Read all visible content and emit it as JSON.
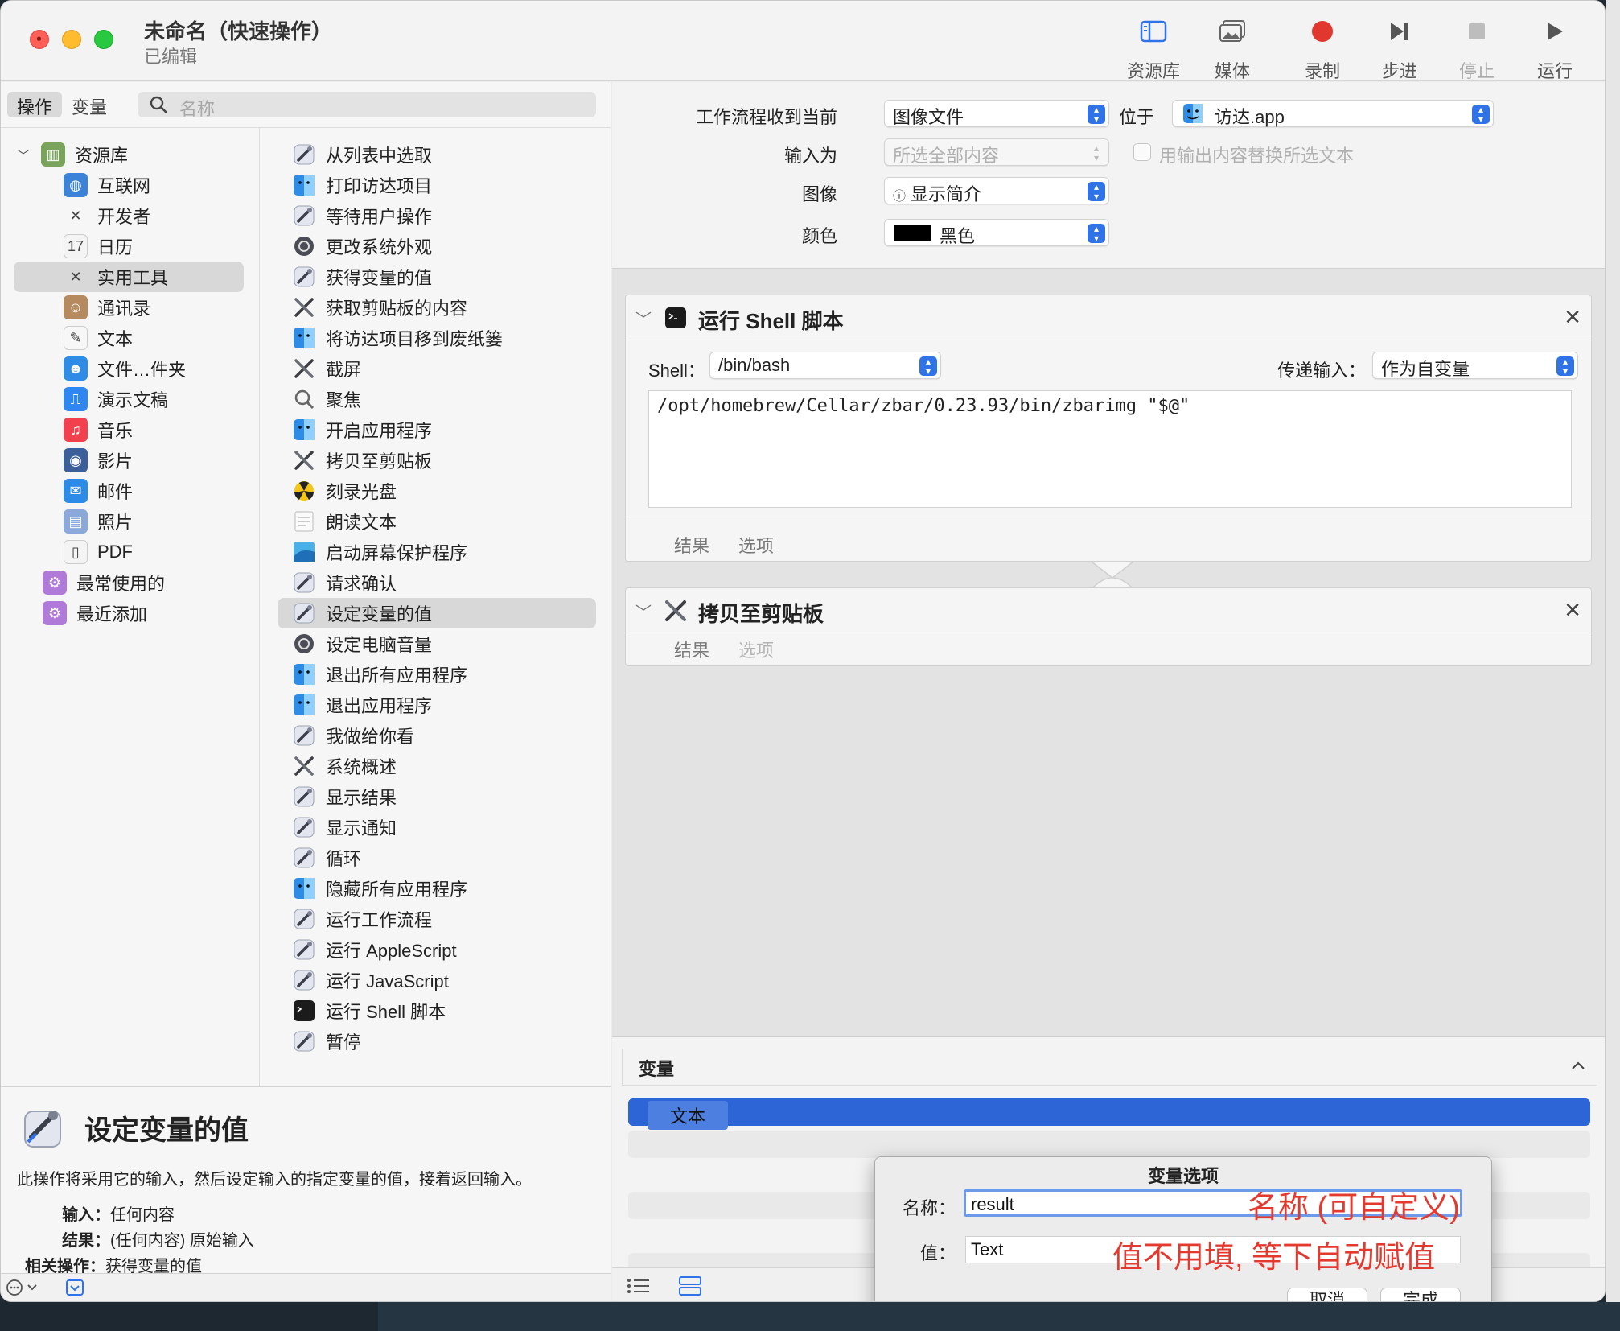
{
  "window": {
    "title": "未命名（快速操作）",
    "subtitle": "已编辑"
  },
  "toolbar": {
    "library": "资源库",
    "media": "媒体",
    "record": "录制",
    "step": "步进",
    "stop": "停止",
    "run": "运行"
  },
  "left": {
    "seg_actions": "操作",
    "seg_variables": "变量",
    "search_placeholder": "名称",
    "library_items": [
      {
        "label": "资源库",
        "icon": "library-icon"
      },
      {
        "label": "互联网",
        "icon": "globe-icon"
      },
      {
        "label": "开发者",
        "icon": "tools-icon"
      },
      {
        "label": "日历",
        "icon": "calendar-icon"
      },
      {
        "label": "实用工具",
        "icon": "tools-icon"
      },
      {
        "label": "通讯录",
        "icon": "contacts-icon"
      },
      {
        "label": "文本",
        "icon": "text-icon"
      },
      {
        "label": "文件…件夹",
        "icon": "finder-icon"
      },
      {
        "label": "演示文稿",
        "icon": "keynote-icon"
      },
      {
        "label": "音乐",
        "icon": "music-icon"
      },
      {
        "label": "影片",
        "icon": "movie-icon"
      },
      {
        "label": "邮件",
        "icon": "mail-icon"
      },
      {
        "label": "照片",
        "icon": "photos-icon"
      },
      {
        "label": "PDF",
        "icon": "pdf-icon"
      },
      {
        "label": "最常使用的",
        "icon": "smart-folder-icon"
      },
      {
        "label": "最近添加",
        "icon": "smart-folder-icon"
      }
    ],
    "actions": [
      "从列表中选取",
      "打印访达项目",
      "等待用户操作",
      "更改系统外观",
      "获得变量的值",
      "获取剪贴板的内容",
      "将访达项目移到废纸篓",
      "截屏",
      "聚焦",
      "开启应用程序",
      "拷贝至剪贴板",
      "刻录光盘",
      "朗读文本",
      "启动屏幕保护程序",
      "请求确认",
      "设定变量的值",
      "设定电脑音量",
      "退出所有应用程序",
      "退出应用程序",
      "我做给你看",
      "系统概述",
      "显示结果",
      "显示通知",
      "循环",
      "隐藏所有应用程序",
      "运行工作流程",
      "运行 AppleScript",
      "运行 JavaScript",
      "运行 Shell 脚本",
      "暂停"
    ],
    "description": {
      "title": "设定变量的值",
      "text": "此操作将采用它的输入，然后设定输入的指定变量的值，接着返回输入。",
      "input_label": "输入：",
      "input_value": "任何内容",
      "result_label": "结果：",
      "result_value": "(任何内容) 原始输入",
      "related_label": "相关操作：",
      "related_value": "获得变量的值"
    }
  },
  "workflow": {
    "receives_label": "工作流程收到当前",
    "receives_value": "图像文件",
    "in_label": "位于",
    "in_value": "访达.app",
    "input_is_label": "输入为",
    "input_is_value": "所选全部内容",
    "replace_label": "用输出内容替换所选文本",
    "image_label": "图像",
    "image_value": "显示简介",
    "color_label": "颜色",
    "color_value": "黑色",
    "color_swatch": "#000000"
  },
  "shell_action": {
    "title": "运行 Shell 脚本",
    "shell_label": "Shell：",
    "shell_value": "/bin/bash",
    "pass_label": "传递输入：",
    "pass_value": "作为自变量",
    "code": "/opt/homebrew/Cellar/zbar/0.23.93/bin/zbarimg \"$@\"",
    "tab_results": "结果",
    "tab_options": "选项"
  },
  "copy_action": {
    "title": "拷贝至剪贴板",
    "tab_results": "结果",
    "tab_options": "选项"
  },
  "variables": {
    "header": "变量",
    "selected": "文本"
  },
  "dialog": {
    "title": "变量选项",
    "name_label": "名称：",
    "name_value": "result",
    "value_label": "值：",
    "value_value": "Text",
    "cancel": "取消",
    "done": "完成"
  },
  "annotations": {
    "name_note": "名称 (可自定义)",
    "value_note": "值不用填, 等下自动赋值",
    "color": "#e33a30"
  }
}
